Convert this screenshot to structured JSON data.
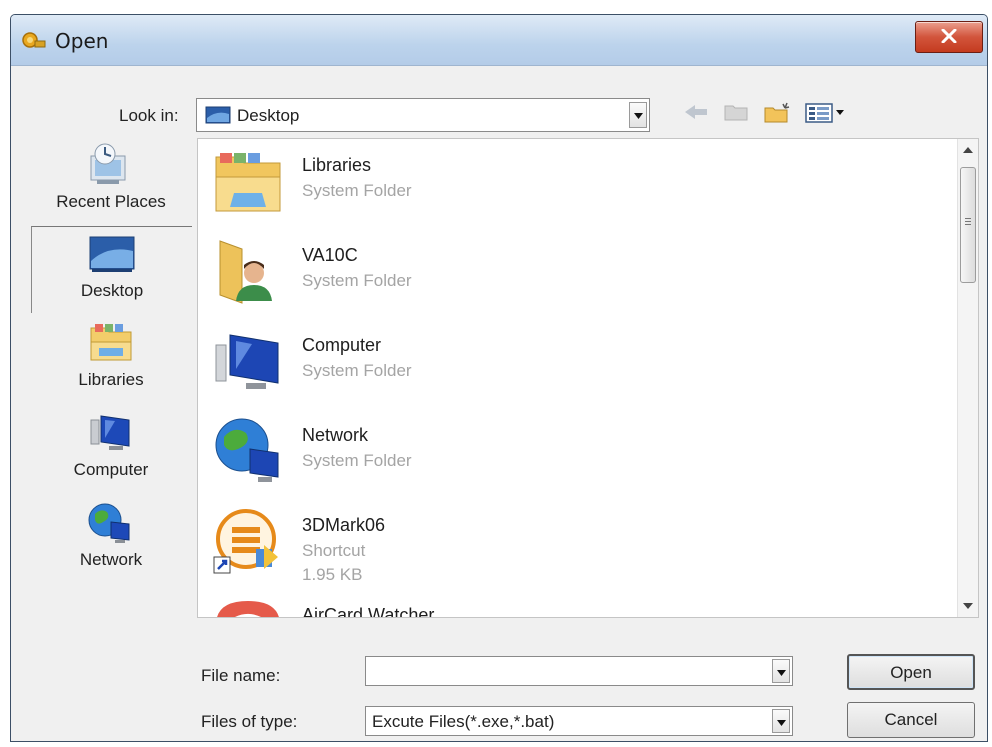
{
  "window": {
    "title": "Open",
    "accent": "#b9d1ea",
    "close_color": "#c43b1f"
  },
  "look_in": {
    "label": "Look in:",
    "value": "Desktop",
    "icon": "desktop-icon"
  },
  "toolbar": {
    "buttons": [
      "back-arrow-icon",
      "up-folder-icon",
      "new-folder-icon",
      "views-menu-icon"
    ]
  },
  "places": [
    {
      "label": "Recent Places",
      "icon": "recent-places-icon"
    },
    {
      "label": "Desktop",
      "icon": "desktop-icon",
      "selected": true
    },
    {
      "label": "Libraries",
      "icon": "libraries-icon"
    },
    {
      "label": "Computer",
      "icon": "computer-icon"
    },
    {
      "label": "Network",
      "icon": "network-icon"
    }
  ],
  "files": [
    {
      "name": "Libraries",
      "type": "System Folder",
      "icon": "libraries-folder-icon"
    },
    {
      "name": "VA10C",
      "type": "System Folder",
      "icon": "user-folder-icon"
    },
    {
      "name": "Computer",
      "type": "System Folder",
      "icon": "computer-icon"
    },
    {
      "name": "Network",
      "type": "System Folder",
      "icon": "network-icon"
    },
    {
      "name": "3DMark06",
      "type": "Shortcut",
      "size": "1.95 KB",
      "icon": "shortcut-icon"
    },
    {
      "name": "AirCard Watcher",
      "icon": "aircard-icon"
    }
  ],
  "file_name": {
    "label": "File name:",
    "value": "",
    "placeholder": ""
  },
  "file_type": {
    "label": "Files of type:",
    "value": "Excute Files(*.exe,*.bat)"
  },
  "buttons": {
    "open": "Open",
    "cancel": "Cancel"
  }
}
